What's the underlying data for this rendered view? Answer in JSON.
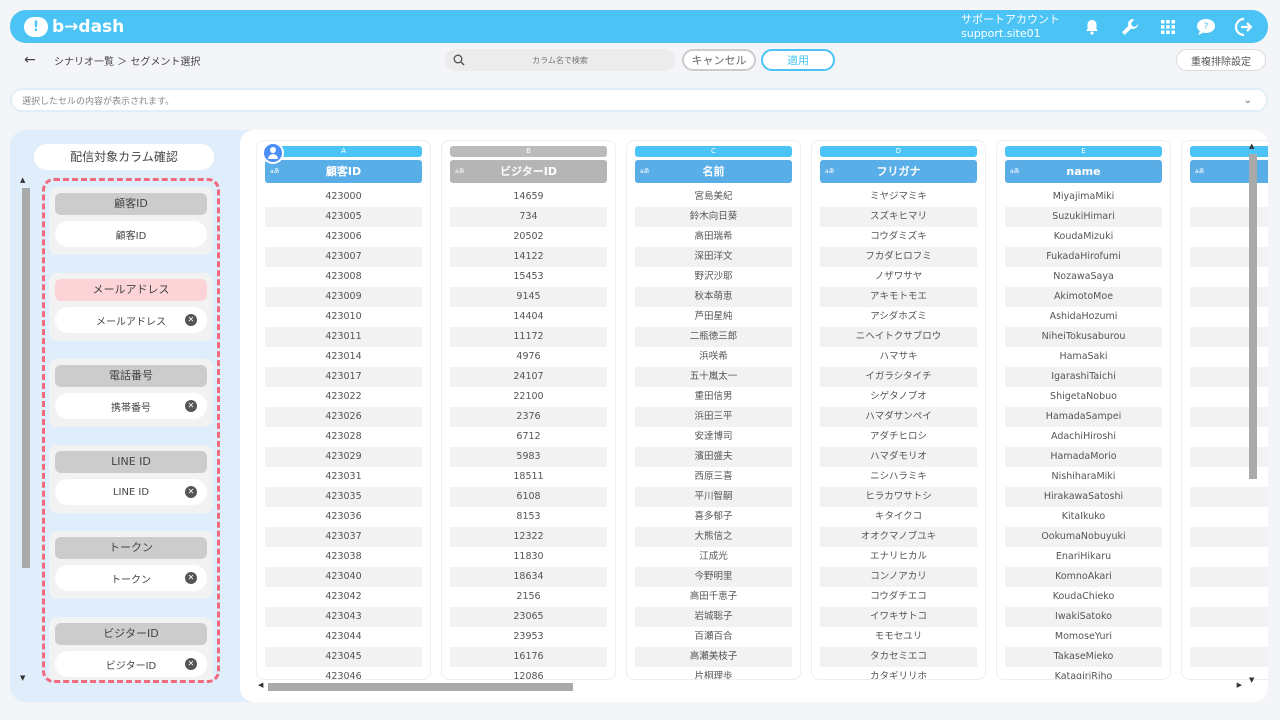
{
  "app": {
    "logo_mark": "!",
    "logo_text": "b→dash",
    "account_label": "サポートアカウント",
    "account_id": "support.site01"
  },
  "toolbar": {
    "back_icon": "←",
    "breadcrumb": "シナリオ一覧 ＞ セグメント選択",
    "search_placeholder": "カラム名で検索",
    "cancel_label": "キャンセル",
    "apply_label": "適用",
    "dedupe_label": "重複排除設定"
  },
  "cellbar": {
    "text": "選択したセルの内容が表示されます。",
    "chevron": "⌄"
  },
  "left_panel": {
    "title": "配信対象カラム確認",
    "groups": [
      {
        "title": "顧客ID",
        "chip": "顧客ID",
        "removable": false,
        "alert": false
      },
      {
        "title": "メールアドレス",
        "chip": "メールアドレス",
        "removable": true,
        "alert": true
      },
      {
        "title": "電話番号",
        "chip": "携帯番号",
        "removable": true,
        "alert": false
      },
      {
        "title": "LINE ID",
        "chip": "LINE ID",
        "removable": true,
        "alert": false
      },
      {
        "title": "トークン",
        "chip": "トークン",
        "removable": true,
        "alert": false
      },
      {
        "title": "ビジターID",
        "chip": "ビジターID",
        "removable": true,
        "alert": false
      }
    ]
  },
  "table": {
    "columns": [
      {
        "letter": "A",
        "type": "aあ",
        "header": "顧客ID",
        "gray": false,
        "cells": [
          "423000",
          "423005",
          "423006",
          "423007",
          "423008",
          "423009",
          "423010",
          "423011",
          "423014",
          "423017",
          "423022",
          "423026",
          "423028",
          "423029",
          "423031",
          "423035",
          "423036",
          "423037",
          "423038",
          "423040",
          "423042",
          "423043",
          "423044",
          "423045",
          "423046"
        ]
      },
      {
        "letter": "B",
        "type": "aあ",
        "header": "ビジターID",
        "gray": true,
        "cells": [
          "14659",
          "734",
          "20502",
          "14122",
          "15453",
          "9145",
          "14404",
          "11172",
          "4976",
          "24107",
          "22100",
          "2376",
          "6712",
          "5983",
          "18511",
          "6108",
          "8153",
          "12322",
          "11830",
          "18634",
          "2156",
          "23065",
          "23953",
          "16176",
          "12086"
        ]
      },
      {
        "letter": "C",
        "type": "aあ",
        "header": "名前",
        "gray": false,
        "cells": [
          "宮島美紀",
          "鈴木向日葵",
          "高田瑞希",
          "深田洋文",
          "野沢沙耶",
          "秋本萌恵",
          "芦田星純",
          "二瓶徳三郎",
          "浜咲希",
          "五十嵐太一",
          "重田信男",
          "浜田三平",
          "安達博司",
          "濱田盛夫",
          "西原三喜",
          "平川智嗣",
          "喜多郁子",
          "大熊信之",
          "江成光",
          "今野明里",
          "高田千恵子",
          "岩城聡子",
          "百瀬百合",
          "高瀬美枝子",
          "片桐理歩"
        ]
      },
      {
        "letter": "D",
        "type": "aあ",
        "header": "フリガナ",
        "gray": false,
        "cells": [
          "ミヤジマミキ",
          "スズキヒマリ",
          "コウダミズキ",
          "フカダヒロフミ",
          "ノザワサヤ",
          "アキモトモエ",
          "アシダホズミ",
          "ニヘイトクサブロウ",
          "ハマサキ",
          "イガラシタイチ",
          "シゲタノブオ",
          "ハマダサンペイ",
          "アダチヒロシ",
          "ハマダモリオ",
          "ニシハラミキ",
          "ヒラカワサトシ",
          "キタイクコ",
          "オオクマノブユキ",
          "エナリヒカル",
          "コンノアカリ",
          "コウダチエコ",
          "イワキサトコ",
          "モモセユリ",
          "タカセミエコ",
          "カタギリリホ"
        ]
      },
      {
        "letter": "E",
        "type": "aあ",
        "header": "name",
        "gray": false,
        "cells": [
          "MiyajimaMiki",
          "SuzukiHimari",
          "KoudaMizuki",
          "FukadaHirofumi",
          "NozawaSaya",
          "AkimotoMoe",
          "AshidaHozumi",
          "NiheiTokusaburou",
          "HamaSaki",
          "IgarashiTaichi",
          "ShigetaNobuo",
          "HamadaSampei",
          "AdachiHiroshi",
          "HamadaMorio",
          "NishiharaMiki",
          "HirakawaSatoshi",
          "KitaIkuko",
          "OokumaNobuyuki",
          "EnariHikaru",
          "KomnoAkari",
          "KoudaChieko",
          "IwakiSatoko",
          "MomoseYuri",
          "TakaseMieko",
          "KatagiriRiho"
        ]
      },
      {
        "letter": "",
        "type": "aあ",
        "header": "",
        "gray": false,
        "cells": []
      }
    ]
  },
  "colors": {
    "accent": "#4bc4f5",
    "header_blue": "#5aaee8",
    "alert_pink": "#f06b7e"
  }
}
